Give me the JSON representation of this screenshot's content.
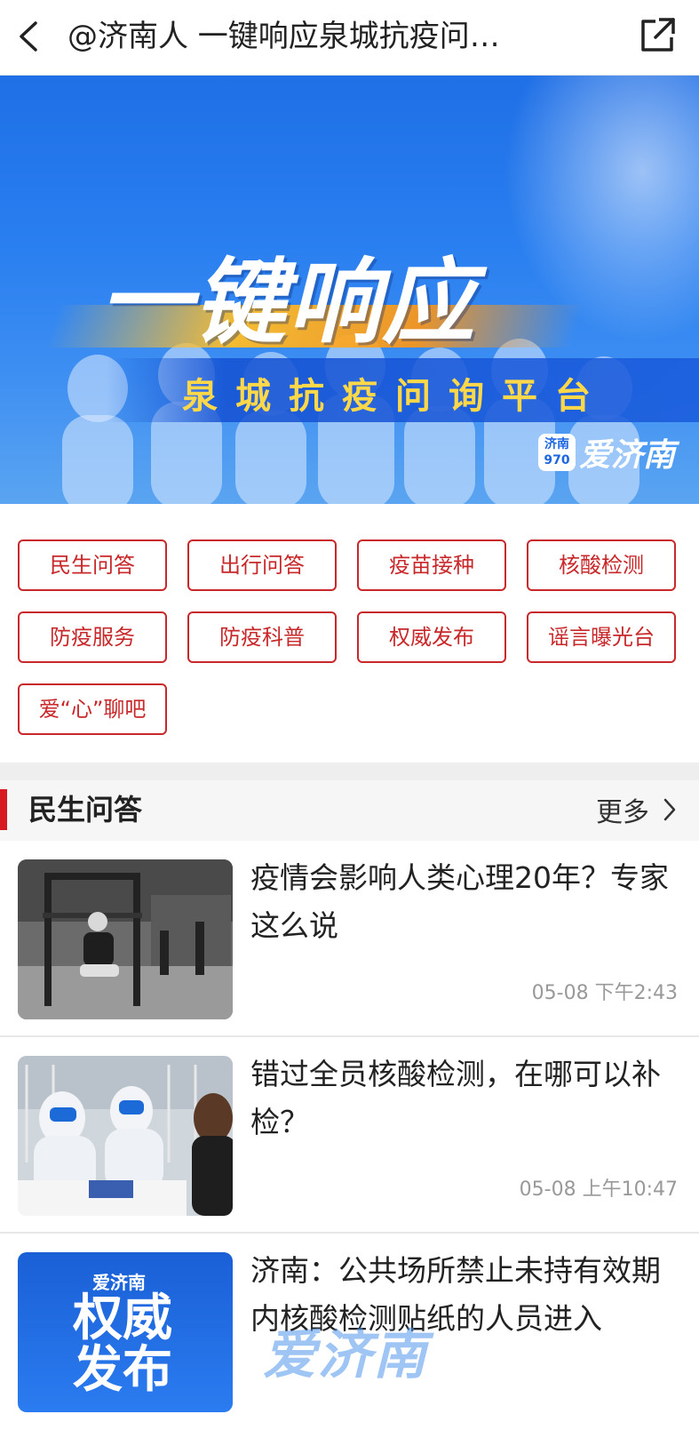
{
  "topbar": {
    "title": "@济南人 一键响应泉城抗疫问…"
  },
  "banner": {
    "title": "一键响应",
    "subtitle": "泉城抗疫问询平台",
    "logo_badge_top": "济南",
    "logo_badge_bottom": "970",
    "logo_text": "爱济南"
  },
  "tags": [
    "民生问答",
    "出行问答",
    "疫苗接种",
    "核酸检测",
    "防疫服务",
    "防疫科普",
    "权威发布",
    "谣言曝光台",
    "爱“心”聊吧"
  ],
  "section": {
    "title": "民生问答",
    "more_label": "更多"
  },
  "articles": [
    {
      "title": "疫情会影响人类心理20年？专家这么说",
      "time": "05-08 下午2:43"
    },
    {
      "title": "错过全员核酸检测，在哪可以补检？",
      "time": "05-08 上午10:47"
    },
    {
      "title": "济南：公共场所禁止未持有效期内核酸检测贴纸的人员进入",
      "time": ""
    }
  ],
  "thumb3": {
    "logo": "爱济南",
    "line1": "权威",
    "line2": "发布"
  },
  "watermark": "爱济南",
  "colors": {
    "accent_red": "#c8282a",
    "banner_blue": "#2a7ff0",
    "subtitle_yellow": "#ffd84a"
  }
}
